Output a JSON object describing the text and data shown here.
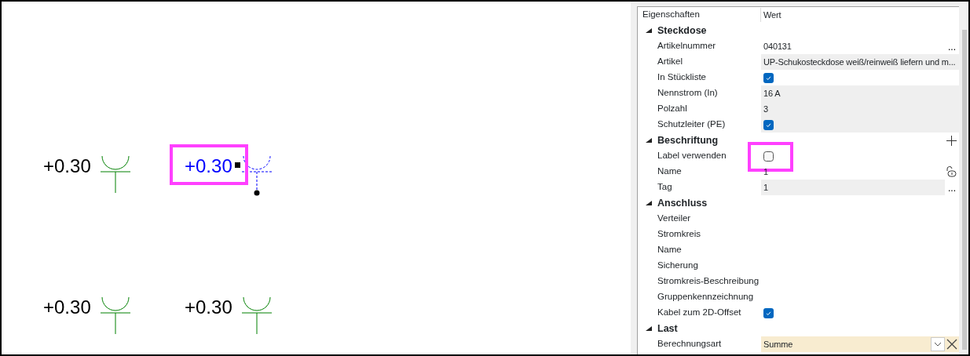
{
  "canvas": {
    "sockets": [
      {
        "label": "+0.30",
        "selected": false,
        "highlighted": false
      },
      {
        "label": "+0.30",
        "selected": true,
        "highlighted": true
      },
      {
        "label": "+0.30",
        "selected": false,
        "highlighted": false
      },
      {
        "label": "+0.30",
        "selected": false,
        "highlighted": false
      }
    ]
  },
  "properties": {
    "columns": [
      "Eigenschaften",
      "Wert"
    ],
    "groups": [
      {
        "title": "Steckdose",
        "expanded": true,
        "add_button": false,
        "rows": [
          {
            "label": "Artikelnummer",
            "kind": "text",
            "value": "040131",
            "readonly": false,
            "button": "..."
          },
          {
            "label": "Artikel",
            "kind": "text",
            "value": "UP-Schukosteckdose weiß/reinweiß liefern und m...",
            "readonly": true
          },
          {
            "label": "In Stückliste",
            "kind": "checkbox",
            "checked": true,
            "readonly": false,
            "highlighted": false
          },
          {
            "label": "Nennstrom (In)",
            "kind": "text",
            "value": "16 A",
            "readonly": true
          },
          {
            "label": "Polzahl",
            "kind": "text",
            "value": "3",
            "readonly": true
          },
          {
            "label": "Schutzleiter (PE)",
            "kind": "checkbox",
            "checked": true,
            "readonly": true,
            "highlighted": false
          }
        ]
      },
      {
        "title": "Beschriftung",
        "expanded": true,
        "add_button": true,
        "rows": [
          {
            "label": "Label verwenden",
            "kind": "checkbox",
            "checked": false,
            "readonly": false,
            "highlighted": true
          },
          {
            "label": "Name",
            "kind": "locked",
            "value": "1",
            "readonly": false
          },
          {
            "label": "Tag",
            "kind": "text",
            "value": "1",
            "readonly": true,
            "button": "..."
          }
        ]
      },
      {
        "title": "Anschluss",
        "expanded": true,
        "add_button": false,
        "rows": [
          {
            "label": "Verteiler",
            "kind": "text",
            "readonly": false
          },
          {
            "label": "Stromkreis",
            "kind": "text",
            "readonly": false
          },
          {
            "label": "Name",
            "kind": "text",
            "readonly": false
          },
          {
            "label": "Sicherung",
            "kind": "text",
            "readonly": false
          },
          {
            "label": "Stromkreis-Beschreibung",
            "kind": "text",
            "readonly": false
          },
          {
            "label": "Gruppenkennzeichnung",
            "kind": "text",
            "readonly": false
          },
          {
            "label": "Kabel zum 2D-Offset",
            "kind": "checkbox",
            "checked": true,
            "readonly": false,
            "highlighted": false
          }
        ]
      },
      {
        "title": "Last",
        "expanded": true,
        "add_button": false,
        "rows": [
          {
            "label": "Berechnungsart",
            "kind": "dropdown",
            "value": "Summe",
            "readonly": false
          }
        ]
      }
    ]
  }
}
